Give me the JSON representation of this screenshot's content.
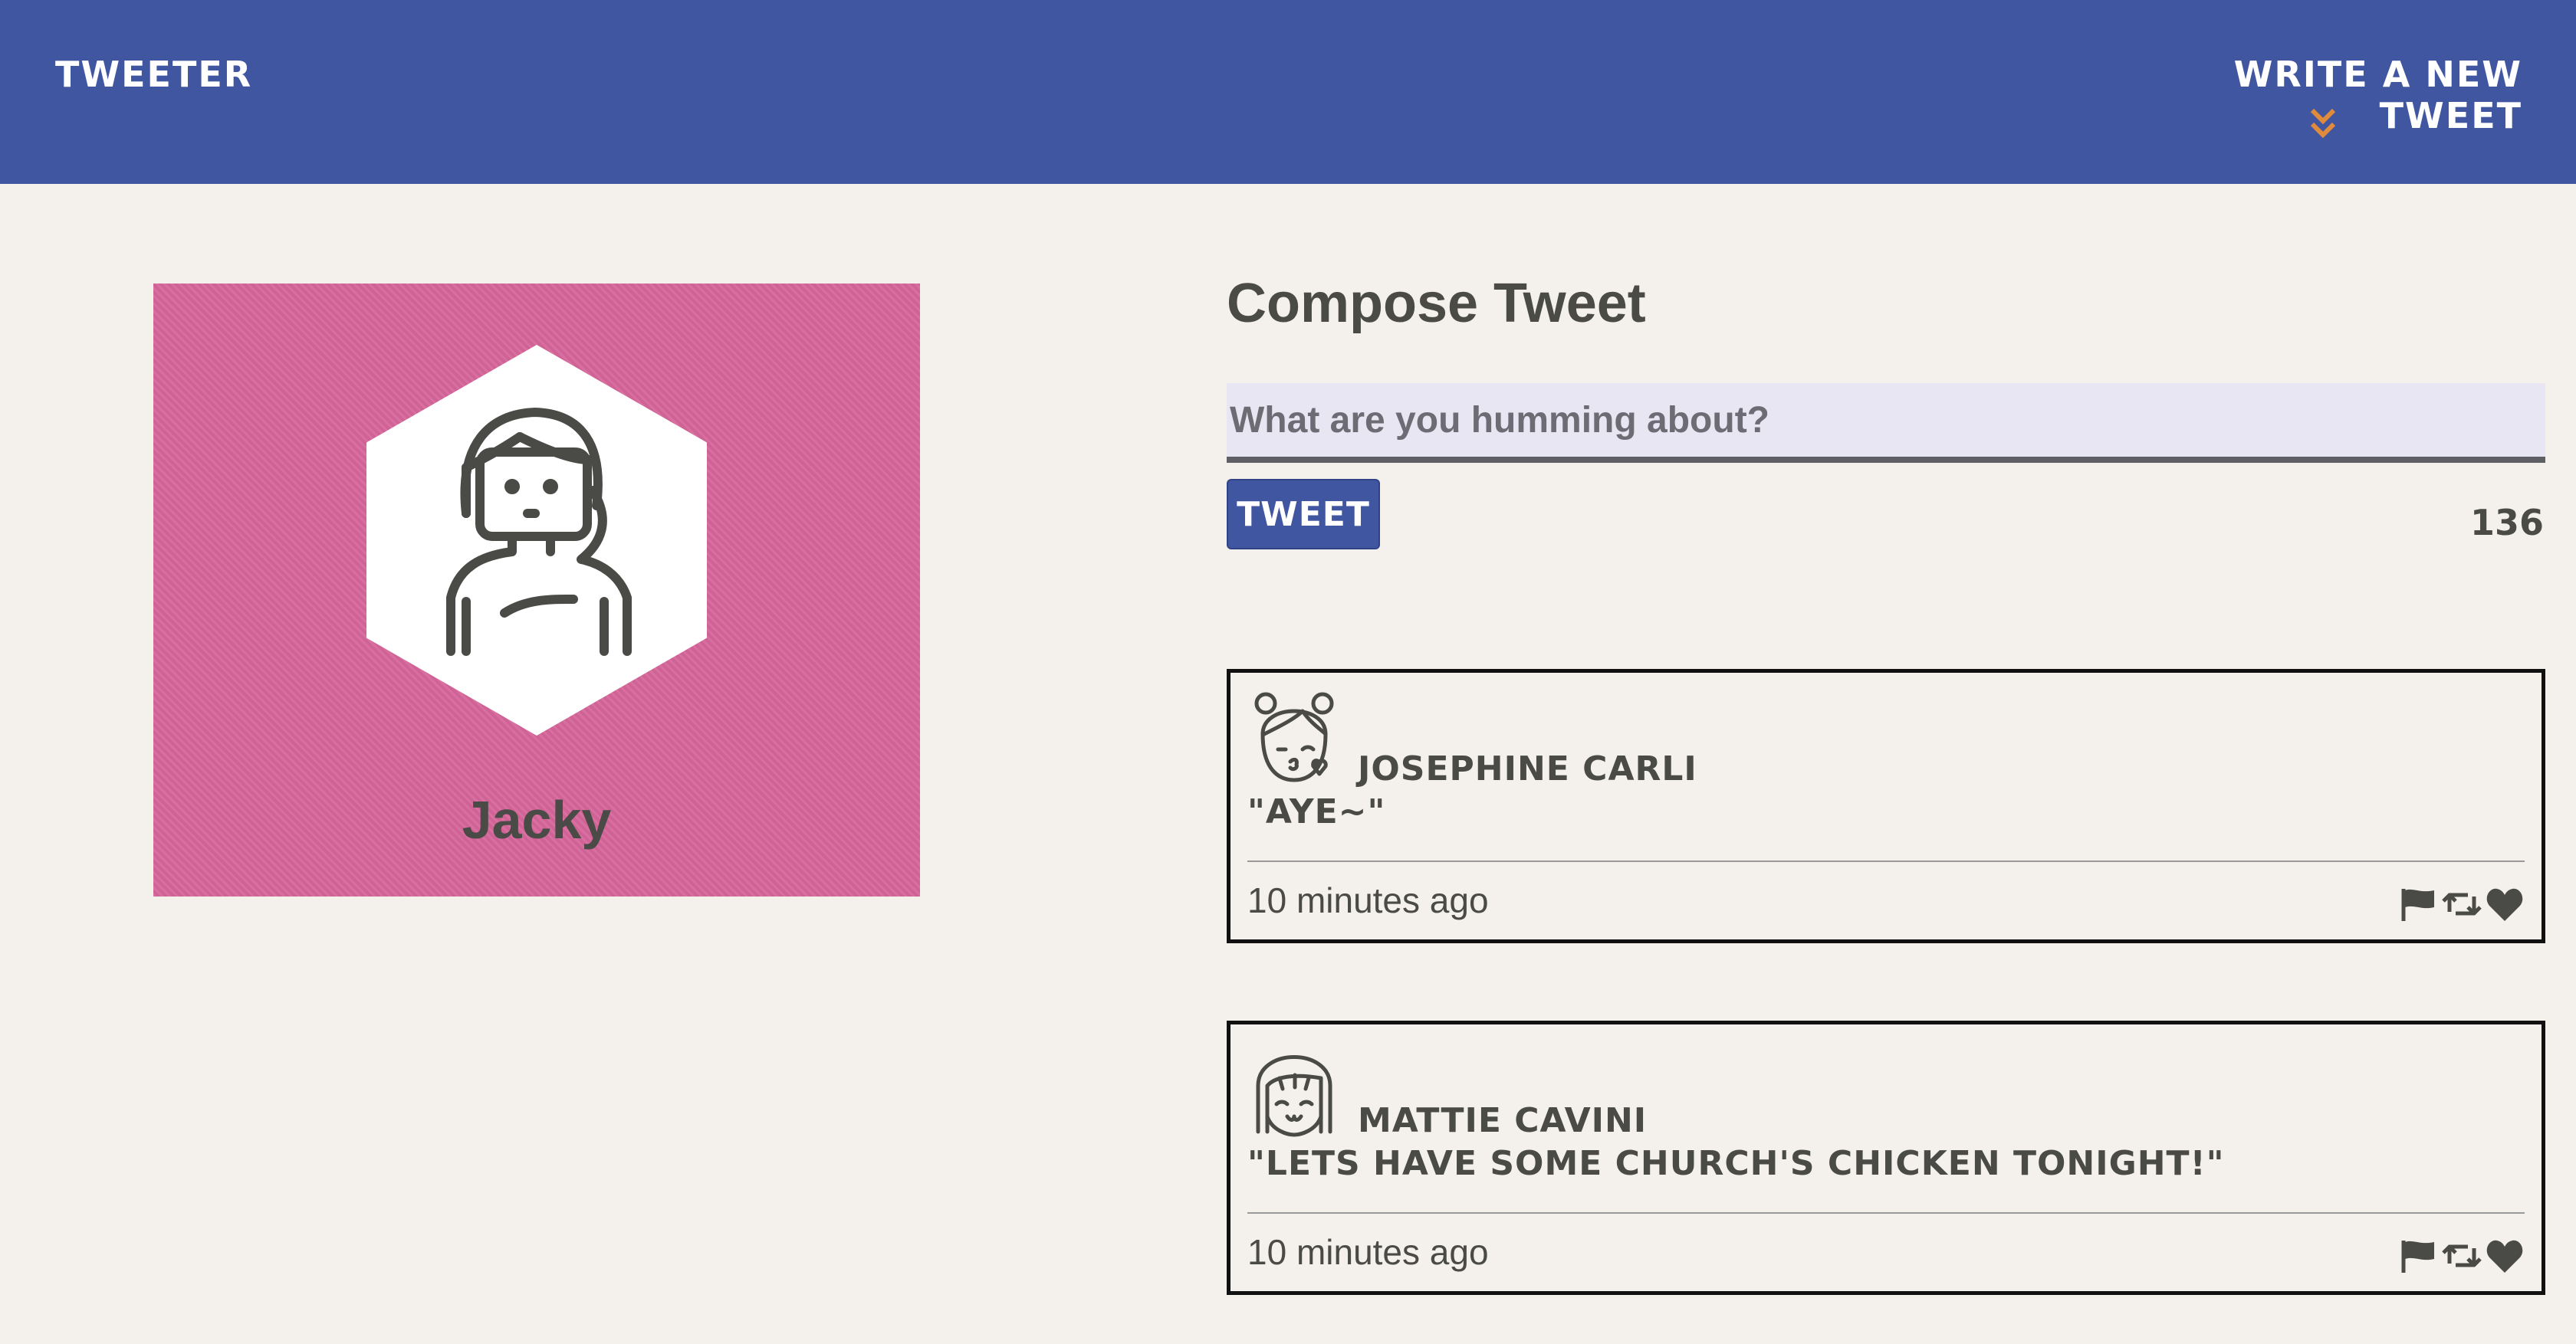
{
  "nav": {
    "brand": "Tweeter",
    "write_link": "Write a new tweet",
    "chevron_icon": "double-chevron-down-icon",
    "chevron_color": "#e08a3c",
    "bg_color": "#4056a0"
  },
  "profile": {
    "name": "Jacky",
    "bg_color": "#d6669a",
    "avatar_icon": "girl-avatar-icon"
  },
  "compose": {
    "title": "Compose Tweet",
    "placeholder": "What are you humming about?",
    "button_label": "Tweet",
    "counter": "136"
  },
  "tweets": [
    {
      "user": "Josephine Carli",
      "text": "\"Aye~\"",
      "time": "10 minutes ago",
      "avatar_icon": "girl-kiss-avatar-icon"
    },
    {
      "user": "Mattie Cavini",
      "text": "\"Lets have some Church's chicken tonight!\"",
      "time": "10 minutes ago",
      "avatar_icon": "girl-smile-avatar-icon"
    }
  ],
  "action_icons": [
    "flag-icon",
    "retweet-icon",
    "heart-icon"
  ]
}
